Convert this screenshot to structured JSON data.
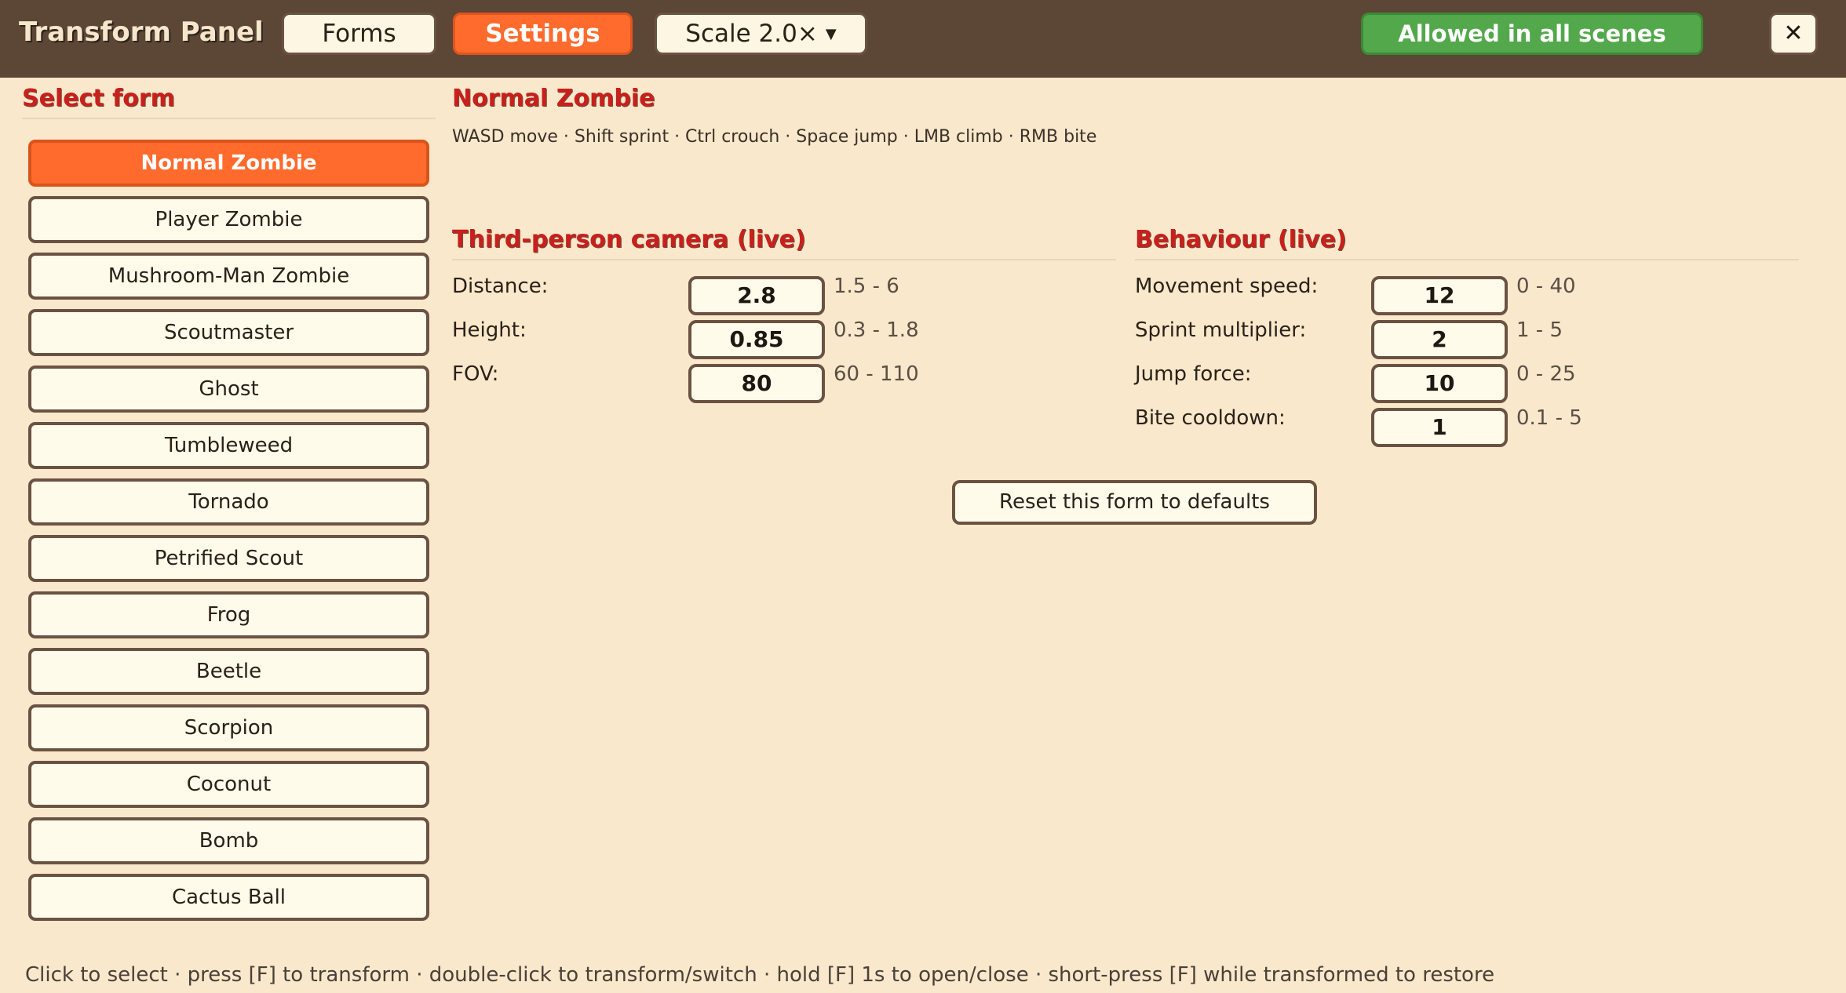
{
  "header": {
    "title": "Transform Panel",
    "tabs": [
      {
        "label": "Forms",
        "active": false
      },
      {
        "label": "Settings",
        "active": true
      }
    ],
    "scale": {
      "label": "Scale 2.0×",
      "caret": "▼"
    },
    "allowed_label": "Allowed in all scenes",
    "close_label": "✕"
  },
  "sidebar": {
    "title": "Select form",
    "selected_index": 0,
    "forms": [
      "Normal Zombie",
      "Player Zombie",
      "Mushroom-Man Zombie",
      "Scoutmaster",
      "Ghost",
      "Tumbleweed",
      "Tornado",
      "Petrified Scout",
      "Frog",
      "Beetle",
      "Scorpion",
      "Coconut",
      "Bomb",
      "Cactus Ball"
    ]
  },
  "main": {
    "form_title": "Normal Zombie",
    "controls_hint": "WASD move · Shift sprint · Ctrl crouch · Space jump · LMB climb · RMB bite",
    "camera": {
      "title": "Third-person camera (live)",
      "fields": [
        {
          "label": "Distance:",
          "value": "2.8",
          "range": "1.5 - 6"
        },
        {
          "label": "Height:",
          "value": "0.85",
          "range": "0.3 - 1.8"
        },
        {
          "label": "FOV:",
          "value": "80",
          "range": "60 - 110"
        }
      ]
    },
    "behaviour": {
      "title": "Behaviour (live)",
      "fields": [
        {
          "label": "Movement speed:",
          "value": "12",
          "range": "0 - 40"
        },
        {
          "label": "Sprint multiplier:",
          "value": "2",
          "range": "1 - 5"
        },
        {
          "label": "Jump force:",
          "value": "10",
          "range": "0 - 25"
        },
        {
          "label": "Bite cooldown:",
          "value": "1",
          "range": "0.1 - 5"
        }
      ]
    },
    "reset_label": "Reset this form to defaults"
  },
  "footer": {
    "hint": "Click to select · press [F] to transform · double-click to transform/switch · hold [F] 1s to open/close · short-press [F] while transformed to restore"
  },
  "colors": {
    "header_bg": "#5c4636",
    "panel_bg": "#f9e8cb",
    "accent_orange": "#ff6b2c",
    "allowed_green": "#52a84a",
    "section_red": "#c8201c"
  },
  "icons": {
    "close": "close-icon",
    "dropdown": "chevron-down-icon"
  }
}
